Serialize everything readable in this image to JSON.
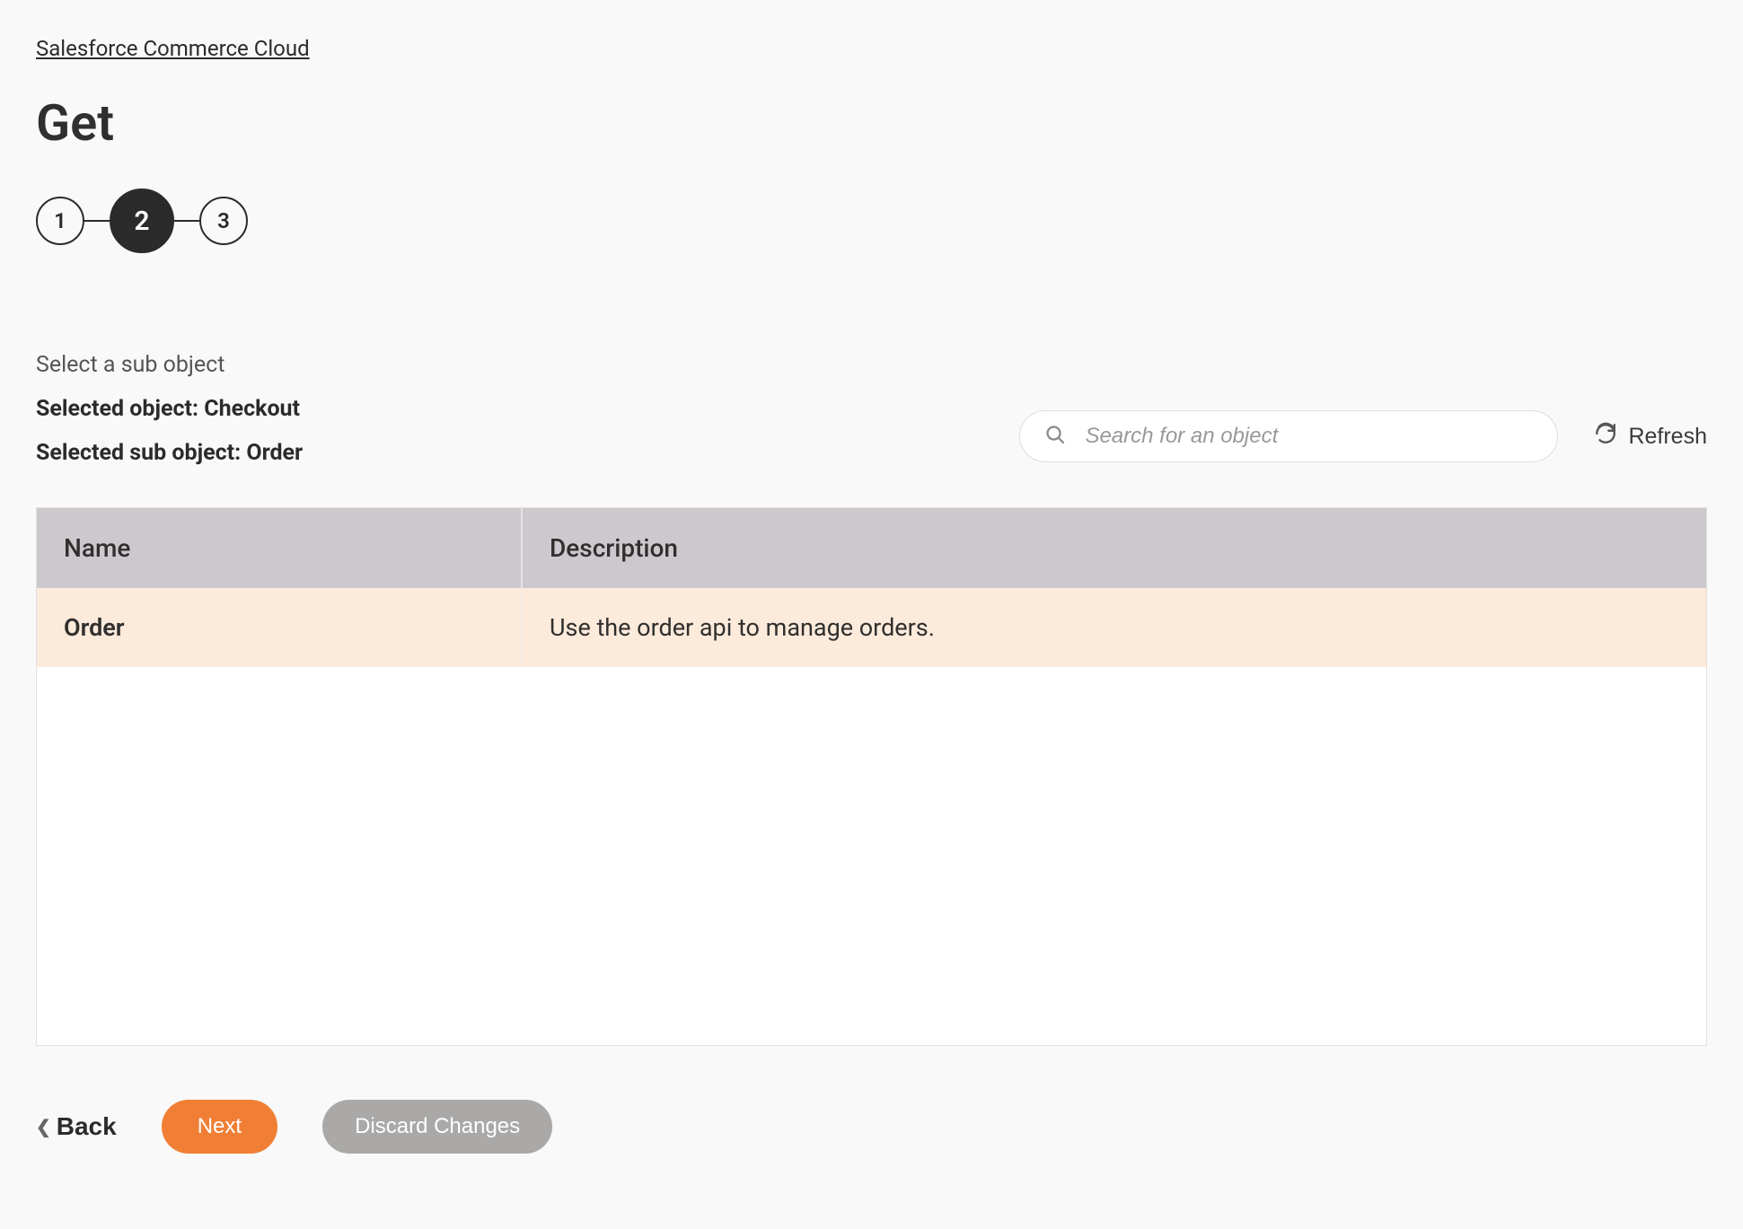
{
  "breadcrumb": "Salesforce Commerce Cloud",
  "page_title": "Get",
  "stepper": {
    "steps": [
      "1",
      "2",
      "3"
    ],
    "active_index": 1
  },
  "instruction": "Select a sub object",
  "selected_object_label": "Selected object: Checkout",
  "selected_sub_object_label": "Selected sub object: Order",
  "search": {
    "placeholder": "Search for an object",
    "value": ""
  },
  "refresh_label": "Refresh",
  "table": {
    "columns": {
      "name": "Name",
      "description": "Description"
    },
    "rows": [
      {
        "name": "Order",
        "description": "Use the order api to manage orders.",
        "selected": true
      }
    ]
  },
  "footer": {
    "back_label": "Back",
    "next_label": "Next",
    "discard_label": "Discard Changes"
  }
}
